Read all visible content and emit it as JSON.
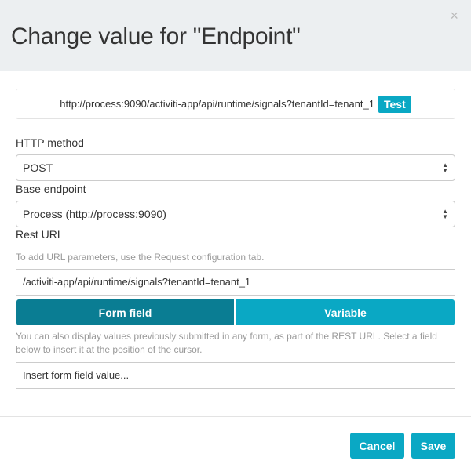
{
  "dialog": {
    "title": "Change value for \"Endpoint\"",
    "close_icon": "×"
  },
  "preview": {
    "url": "http://process:9090/activiti-app/api/runtime/signals?tenantId=tenant_1",
    "test_label": "Test"
  },
  "http_method": {
    "label": "HTTP method",
    "value": "POST"
  },
  "base_endpoint": {
    "label": "Base endpoint",
    "value": "Process (http://process:9090)"
  },
  "rest_url": {
    "label": "Rest URL",
    "hint": "To add URL parameters, use the Request configuration tab.",
    "value": "/activiti-app/api/runtime/signals?tenantId=tenant_1"
  },
  "tabs": [
    {
      "label": "Form field",
      "active": true
    },
    {
      "label": "Variable",
      "active": false
    }
  ],
  "insert": {
    "help": "You can also display values previously submitted in any form, as part of the REST URL. Select a field below to insert it at the position of the cursor.",
    "placeholder": "Insert form field value..."
  },
  "footer": {
    "cancel": "Cancel",
    "save": "Save"
  },
  "colors": {
    "accent": "#0aa8c4",
    "active_tab": "#0a7d93"
  }
}
